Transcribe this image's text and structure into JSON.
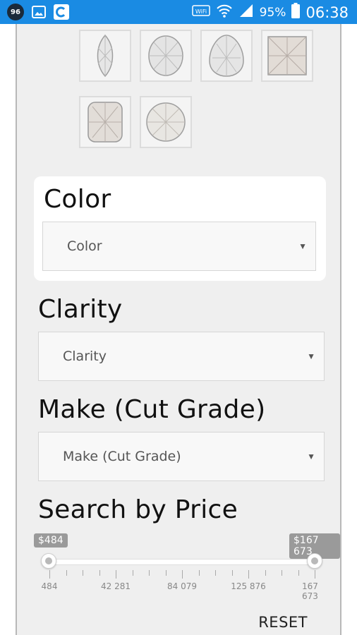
{
  "status_bar": {
    "badge": "96",
    "network": "WiFi",
    "battery": "95%",
    "time": "06:38"
  },
  "shapes": [
    "marquise",
    "oval",
    "pear",
    "princess",
    "cushion",
    "round"
  ],
  "filters": {
    "color": {
      "heading": "Color",
      "selected": "Color"
    },
    "clarity": {
      "heading": "Clarity",
      "selected": "Clarity"
    },
    "make": {
      "heading": "Make (Cut Grade)",
      "selected": "Make (Cut Grade)"
    }
  },
  "price": {
    "heading": "Search by Price",
    "min_tag": "$484",
    "max_tag": "$167 673",
    "tick_labels": [
      "484",
      "42 281",
      "84 079",
      "125 876",
      "167 673"
    ]
  },
  "reset_label": "RESET"
}
